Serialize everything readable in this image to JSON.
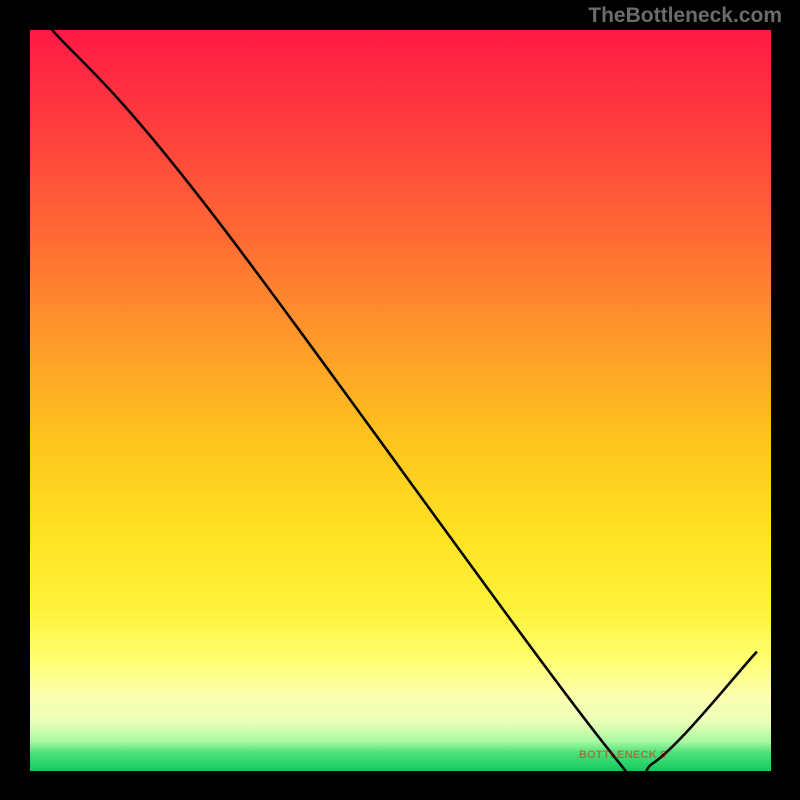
{
  "watermark": "TheBottleneck.com",
  "bottom_label": "BOTTLENECK 0",
  "chart_data": {
    "type": "line",
    "title": "",
    "xlabel": "",
    "ylabel": "",
    "xlim": [
      0,
      100
    ],
    "ylim": [
      0,
      100
    ],
    "series": [
      {
        "name": "curve",
        "points": [
          {
            "x": 3,
            "y": 100
          },
          {
            "x": 24,
            "y": 76
          },
          {
            "x": 78,
            "y": 3
          },
          {
            "x": 84,
            "y": 1
          },
          {
            "x": 98,
            "y": 16
          }
        ]
      }
    ],
    "gradient": {
      "top_color": "#ff1a44",
      "mid_color": "#ffe223",
      "bottom_color": "#14c95e"
    },
    "bottom_label_x_percent": 80
  }
}
